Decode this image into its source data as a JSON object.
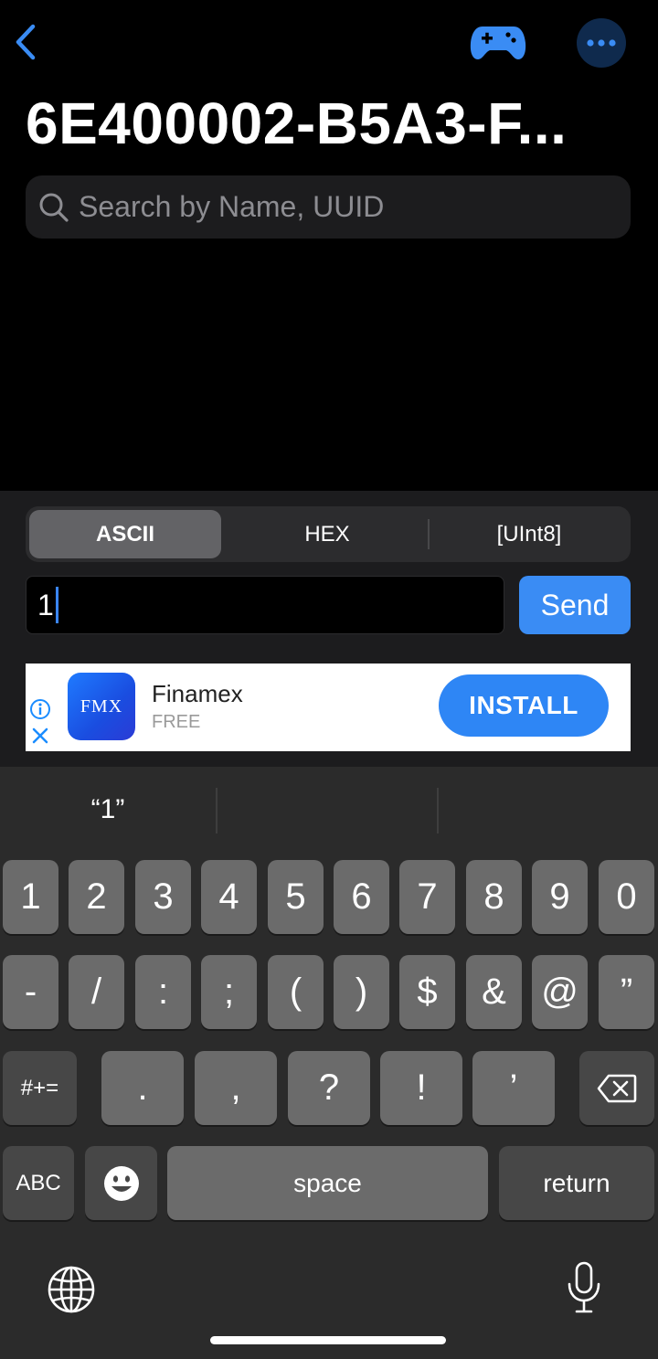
{
  "nav": {
    "title": "6E400002-B5A3-F...",
    "accent_color": "#3a8cf4",
    "icons": [
      "chevron-left-icon",
      "gamepad-icon",
      "ellipsis-icon"
    ]
  },
  "search": {
    "placeholder": "Search by Name, UUID",
    "value": ""
  },
  "format_tabs": [
    {
      "label": "ASCII",
      "selected": true
    },
    {
      "label": "HEX",
      "selected": false
    },
    {
      "label": "[UInt8]",
      "selected": false
    }
  ],
  "send_field": {
    "value": "1",
    "button_label": "Send"
  },
  "ad": {
    "app_icon_text": "FMX",
    "app_name": "Finamex",
    "price": "FREE",
    "install_label": "INSTALL",
    "icons": [
      "info-icon",
      "close-icon"
    ]
  },
  "keyboard": {
    "suggestions": [
      "“1”",
      "",
      ""
    ],
    "row1": [
      "1",
      "2",
      "3",
      "4",
      "5",
      "6",
      "7",
      "8",
      "9",
      "0"
    ],
    "row2": [
      "-",
      "/",
      ":",
      ";",
      "(",
      ")",
      "$",
      "&",
      "@",
      "”"
    ],
    "row3_left": "#+=",
    "row3": [
      ".",
      ",",
      "?",
      "!",
      "’"
    ],
    "abc_label": "ABC",
    "space_label": "space",
    "return_label": "return",
    "icons": [
      "backspace-icon",
      "emoji-icon",
      "globe-icon",
      "microphone-icon"
    ]
  }
}
